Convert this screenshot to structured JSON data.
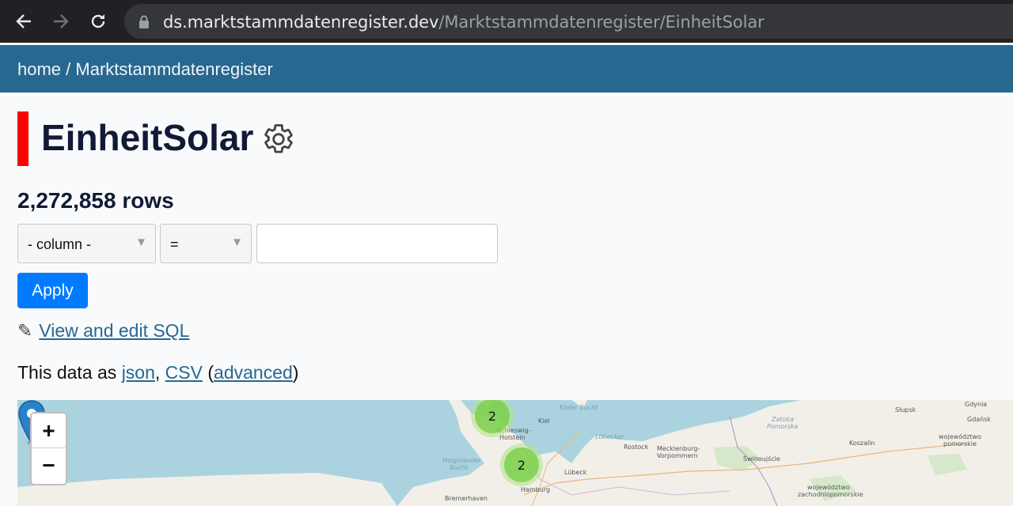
{
  "browser": {
    "url_host": "ds.marktstammdatenregister.dev",
    "url_path": "/Marktstammdatenregister/EinheitSolar"
  },
  "breadcrumb": {
    "home": "home",
    "separator": " / ",
    "database": "Marktstammdatenregister"
  },
  "page": {
    "title": "EinheitSolar",
    "row_count": "2,272,858 rows"
  },
  "filter": {
    "column_select": "- column -",
    "operator_select": "=",
    "value_input": "",
    "apply_label": "Apply"
  },
  "links": {
    "pencil": "✎",
    "sql": "View and edit SQL",
    "data_prefix": "This data as ",
    "json": "json",
    "comma": ", ",
    "csv": "CSV",
    "paren_open": " (",
    "advanced": "advanced",
    "paren_close": ")"
  },
  "map": {
    "zoom_in": "+",
    "zoom_out": "−",
    "clusters": [
      {
        "count": "2"
      },
      {
        "count": "2"
      }
    ],
    "labels": {
      "kiel": "Kiel",
      "kieler_bucht": "Kieler Bucht",
      "schleswig": "Schleswig-",
      "holstein": "Holstein",
      "helgolander": "Helgoländer",
      "bucht": "Bucht",
      "lubeck": "Lübeck",
      "lubecker": "Lübecker",
      "hamburg": "Hamburg",
      "bremerhaven": "Bremerhaven",
      "rostock": "Rostock",
      "mecklenburg": "Mecklenburg-",
      "vorpommern": "Vorpommern",
      "swinoujscie": "Świnoujście",
      "slupsk": "Słupsk",
      "gdynia": "Gdynia",
      "gdansk": "Gdańsk",
      "koszalin": "Koszalin",
      "wojewodztwo_pomorskie_1": "województwo",
      "wojewodztwo_pomorskie_2": "pomorskie",
      "zatoka": "Zatoka",
      "pomorska": "Pomorska",
      "wojewodztwo_zach_1": "województwo",
      "wojewodztwo_zach_2": "zachodniopomorskie"
    },
    "colors": {
      "water": "#aad3df",
      "land": "#f2efe9",
      "cluster": "#6ecc39",
      "marker": "#2a81cb"
    }
  }
}
